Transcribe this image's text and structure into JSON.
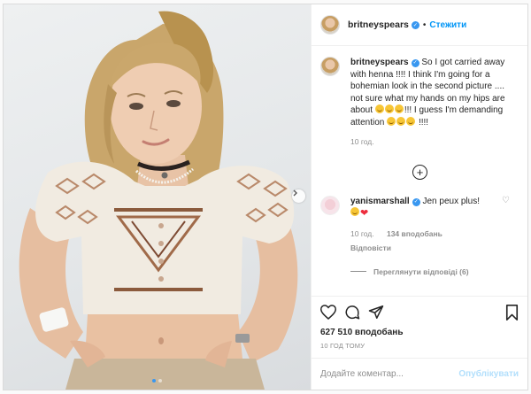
{
  "author": {
    "username": "britneyspears",
    "separator": "•",
    "follow_label": "Стежити"
  },
  "caption": {
    "username": "britneyspears",
    "text_1": "So I got carried away with henna !!!!  I think I'm going for a bohemian look in the second picture .... not sure what my hands on my hips are about",
    "text_2": "!!! I guess I'm demanding attention",
    "text_3": "!!!!",
    "time": "10 год."
  },
  "load_more": "+",
  "comment": {
    "username": "yanismarshall",
    "text": "Jen peux plus!",
    "time": "10 год.",
    "likes": "134 вподобань",
    "reply_label": "Відповісти",
    "view_replies": "Переглянути відповіді (6)"
  },
  "likes": "627 510 вподобань",
  "posted_ago": "10 ГОД ТОМУ",
  "input": {
    "placeholder": "Додайте коментар..."
  },
  "publish_label": "Опублікувати",
  "carousel": {
    "slides": 2,
    "active_slide": 1
  },
  "icons": [
    "chevron-right-icon",
    "heart-icon",
    "comment-icon",
    "share-icon",
    "bookmark-icon",
    "plus-circle-icon",
    "verified-icon"
  ],
  "colors": {
    "link": "#0095f6",
    "verified": "#3897f0",
    "muted": "#8e8e8e",
    "publish_disabled": "#b2dffc",
    "heart": "#ed2d3d"
  }
}
